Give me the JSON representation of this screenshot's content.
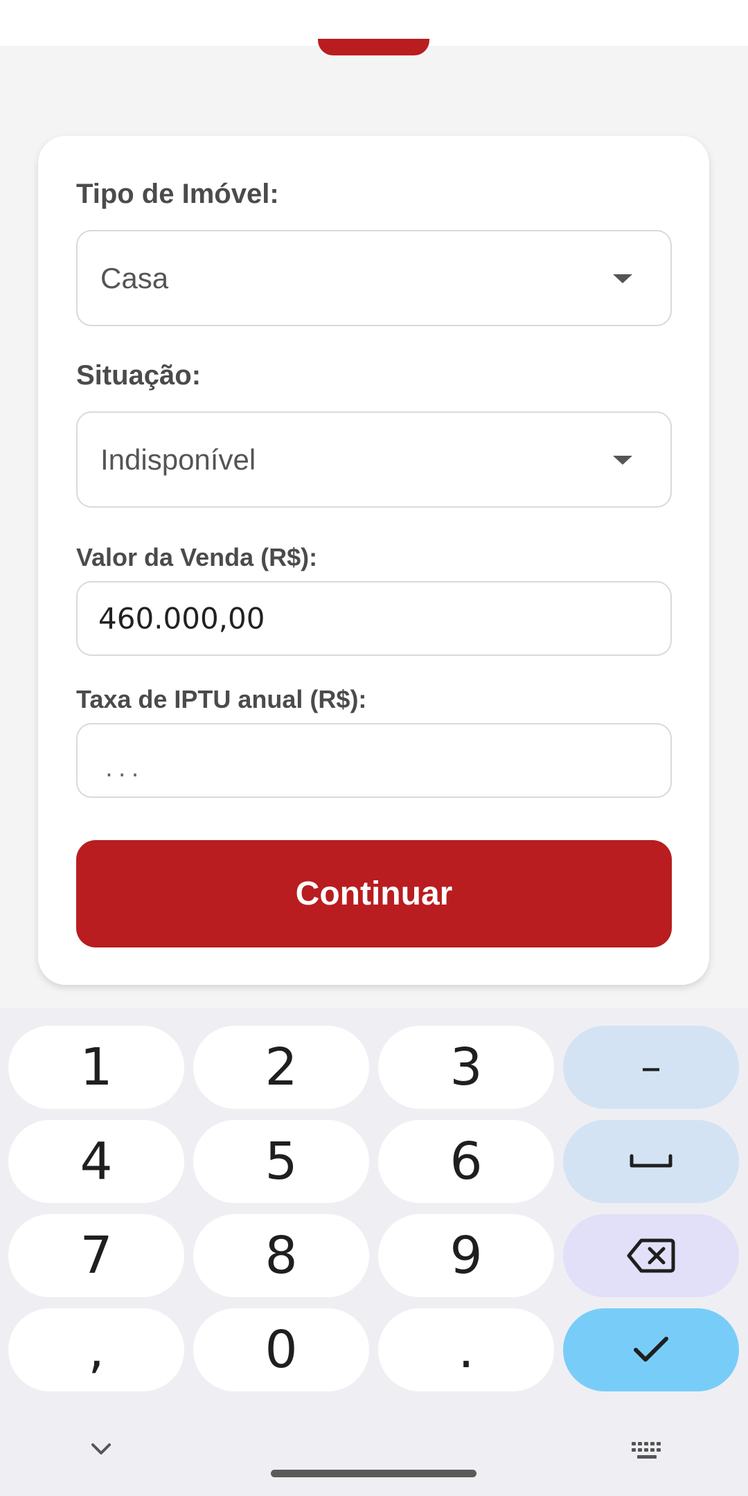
{
  "form": {
    "property_type_label": "Tipo de Imóvel:",
    "property_type_value": "Casa",
    "situation_label": "Situação:",
    "situation_value": "Indisponível",
    "sale_value_label": "Valor da Venda (R$):",
    "sale_value": "460.000,00",
    "iptu_label": "Taxa de IPTU anual (R$):",
    "iptu_placeholder": "...",
    "continue_label": "Continuar"
  },
  "keyboard": {
    "keys": [
      "1",
      "2",
      "3",
      "–",
      "4",
      "5",
      "6",
      "space-icon",
      "7",
      "8",
      "9",
      "backspace-icon",
      ",",
      "0",
      ".",
      "check-icon"
    ]
  },
  "navigation": {
    "icons": [
      "chevron-down-icon",
      "home-pill",
      "keyboard-icon"
    ]
  },
  "colors": {
    "accent": "#b91d20",
    "key_func": "#d3e3f3",
    "key_delete": "#e2dff8",
    "key_enter": "#78cdf8"
  }
}
